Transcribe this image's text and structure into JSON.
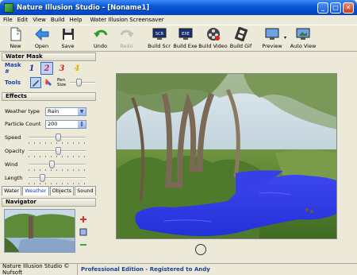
{
  "window": {
    "title": "Nature Illusion Studio - [Noname1]",
    "minimize": "_",
    "maximize": "□",
    "close": "✕"
  },
  "menu": [
    "File",
    "Edit",
    "View",
    "Build",
    "Help",
    "Water Illusion Screensaver"
  ],
  "toolbar": {
    "new": "New",
    "open": "Open",
    "save": "Save",
    "undo": "Undo",
    "redo": "Redo",
    "build_scr": "Build Scr",
    "build_exe": "Build Exe",
    "build_video": "Build Video",
    "build_gif": "Build Gif",
    "preview": "Preview",
    "auto_view": "Auto View"
  },
  "water_mask": {
    "heading": "Water Mask",
    "mask_label": "Mask #",
    "masks": [
      "1",
      "2",
      "3",
      "4"
    ],
    "mask_colors": [
      "#1f2fb5",
      "#cc1a8a",
      "#d42020",
      "#d8b800"
    ],
    "selected_mask": "2",
    "tools_label": "Tools",
    "pen_size_label": "Pen Size",
    "pen_size_level": 0.3
  },
  "effects": {
    "heading": "Effects",
    "weather_type_label": "Weather type",
    "weather_type_value": "Rain",
    "particle_count_label": "Particle Count",
    "particle_count_value": "200",
    "sliders": [
      {
        "label": "Speed",
        "level": 0.52
      },
      {
        "label": "Opacity",
        "level": 0.52
      },
      {
        "label": "Wind",
        "level": 0.4
      },
      {
        "label": "Length",
        "level": 0.22
      }
    ]
  },
  "tabs": [
    "Water",
    "Weather",
    "Objects",
    "Sound"
  ],
  "active_tab": "Weather",
  "navigator": {
    "heading": "Navigator"
  },
  "status": {
    "left": "Nature Illusion Studio © Nufsoft",
    "right": "Professional Edition - Registered to Andy"
  }
}
